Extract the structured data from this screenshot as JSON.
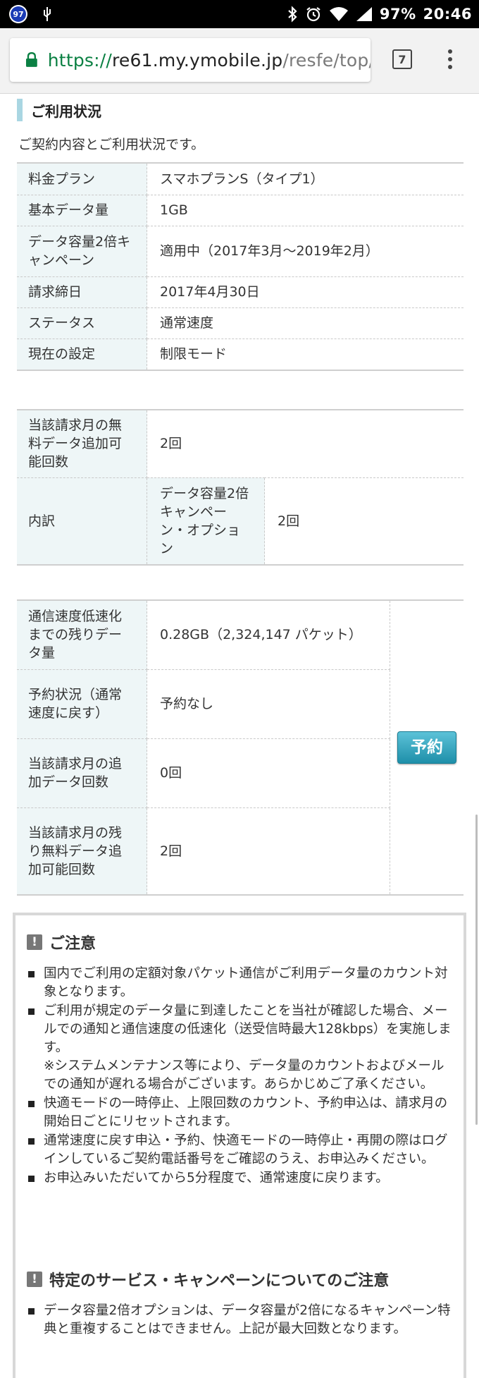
{
  "status_bar": {
    "notification_badge": "97",
    "battery_percent": "97%",
    "time": "20:46"
  },
  "browser": {
    "url_scheme": "https://",
    "url_host": "re61.my.ymobile.jp",
    "url_path": "/resfe/top/",
    "tab_count": "7"
  },
  "usage": {
    "heading": "ご利用状況",
    "intro": "ご契約内容とご利用状況です。",
    "contract_rows": [
      {
        "label": "料金プラン",
        "value": "スマホプランS（タイプ1）"
      },
      {
        "label": "基本データ量",
        "value": "1GB"
      },
      {
        "label": "データ容量2倍キャンペーン",
        "value": "適用中（2017年3月〜2019年2月）"
      },
      {
        "label": "請求締日",
        "value": "2017年4月30日"
      },
      {
        "label": "ステータス",
        "value": "通常速度"
      },
      {
        "label": "現在の設定",
        "value": "制限モード"
      }
    ],
    "free_data": {
      "label": "当該請求月の無料データ追加可能回数",
      "value": "2回",
      "breakdown_label": "内訳",
      "breakdown_item": "データ容量2倍キャンペーン・オプション",
      "breakdown_value": "2回"
    },
    "speed_rows": [
      {
        "label": "通信速度低速化までの残りデータ量",
        "value": "0.28GB（2,324,147 パケット）"
      },
      {
        "label": "予約状況（通常速度に戻す）",
        "value": "予約なし"
      },
      {
        "label": "当該請求月の追加データ回数",
        "value": "0回"
      },
      {
        "label": "当該請求月の残り無料データ追加可能回数",
        "value": "2回"
      }
    ],
    "reserve_button": "予約"
  },
  "notice": {
    "heading": "ご注意",
    "items": [
      {
        "text": "国内でご利用の定額対象パケット通信がご利用データ量のカウント対象となります。"
      },
      {
        "text": "ご利用が規定のデータ量に到達したことを当社が確認した場合、メールでの通知と通信速度の低速化（送受信時最大128kbps）を実施します。",
        "sub": "※システムメンテナンス等により、データ量のカウントおよびメールでの通知が遅れる場合がございます。あらかじめご了承ください。"
      },
      {
        "text": "快適モードの一時停止、上限回数のカウント、予約申込は、請求月の開始日ごとにリセットされます。"
      },
      {
        "text": "通常速度に戻す申込・予約、快適モードの一時停止・再開の際はログインしているご契約電話番号をご確認のうえ、お申込みください。"
      },
      {
        "text": "お申込みいただいてから5分程度で、通常速度に戻ります。"
      }
    ],
    "heading2": "特定のサービス・キャンペーンについてのご注意",
    "items2": [
      {
        "text": "データ容量2倍オプションは、データ容量が2倍になるキャンペーン特典と重複することはできません。上記が最大回数となります。"
      }
    ]
  }
}
